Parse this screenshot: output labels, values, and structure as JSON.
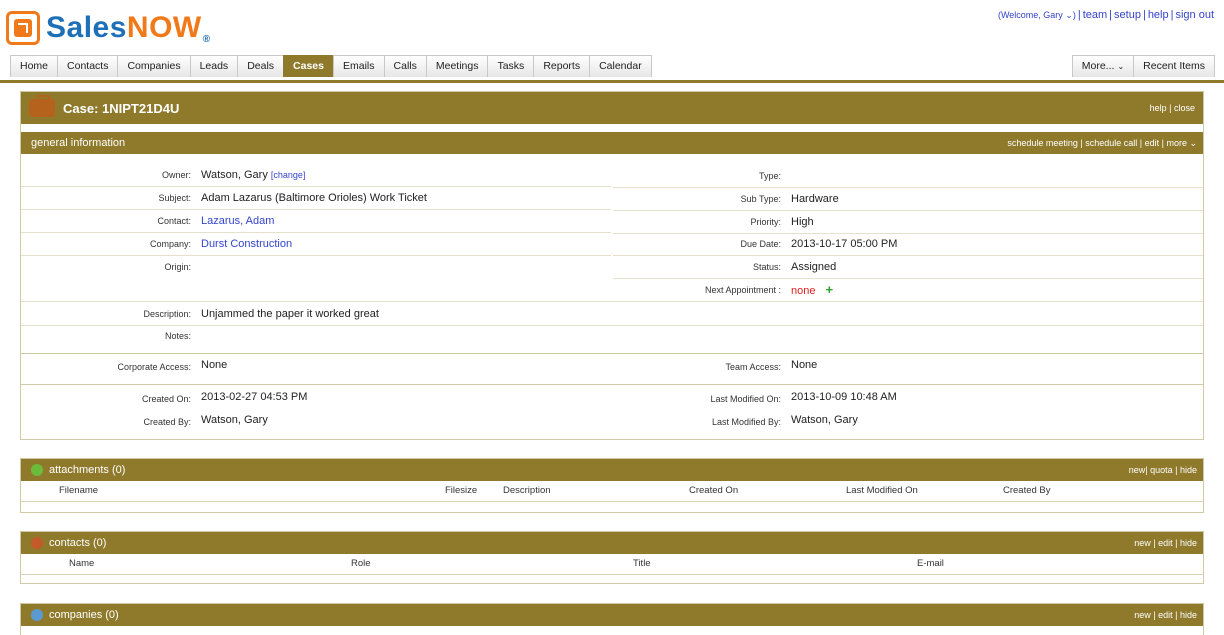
{
  "brand": {
    "sales": "Sales",
    "now": "NOW",
    "reg": "®"
  },
  "toplinks": {
    "welcome": "(Welcome, Gary ⌄)",
    "team": "team",
    "setup": "setup",
    "help": "help",
    "signout": "sign out"
  },
  "tabs": [
    "Home",
    "Contacts",
    "Companies",
    "Leads",
    "Deals",
    "Cases",
    "Emails",
    "Calls",
    "Meetings",
    "Tasks",
    "Reports",
    "Calendar"
  ],
  "active_tab": "Cases",
  "tabs_right": {
    "more": "More...",
    "more_dd": "⌄",
    "recent": "Recent Items"
  },
  "case": {
    "title": "Case: 1NIPT21D4U",
    "head_links": {
      "help": "help",
      "close": "close"
    },
    "section": "general information",
    "section_links": {
      "schedule_meeting": "schedule meeting",
      "schedule_call": "schedule call",
      "edit": "edit",
      "more": "more ⌄"
    },
    "fields_left": [
      {
        "label": "Owner:",
        "value": "Watson, Gary",
        "extra": "[change]"
      },
      {
        "label": "Subject:",
        "value": "Adam Lazarus (Baltimore Orioles) Work Ticket"
      },
      {
        "label": "Contact:",
        "value": "Lazarus, Adam"
      },
      {
        "label": "Company:",
        "value": "Durst Construction"
      },
      {
        "label": "Origin:",
        "value": ""
      }
    ],
    "fields_right": [
      {
        "label": "Type:",
        "value": ""
      },
      {
        "label": "Sub Type:",
        "value": "Hardware"
      },
      {
        "label": "Priority:",
        "value": "High"
      },
      {
        "label": "Due Date:",
        "value": "2013-10-17 05:00 PM"
      },
      {
        "label": "Status:",
        "value": "Assigned"
      },
      {
        "label": "Next Appointment :",
        "value": "none",
        "plus": "+"
      }
    ],
    "description_label": "Description:",
    "description": "Unjammed the paper it worked great",
    "notes_label": "Notes:",
    "corporate_access_label": "Corporate Access:",
    "corporate_access": "None",
    "team_access_label": "Team Access:",
    "team_access": "None",
    "created_on_label": "Created On:",
    "created_on": "2013-02-27 04:53 PM",
    "created_by_label": "Created By:",
    "created_by": "Watson, Gary",
    "modified_on_label": "Last Modified On:",
    "modified_on": "2013-10-09 10:48 AM",
    "modified_by_label": "Last Modified By:",
    "modified_by": "Watson, Gary"
  },
  "attachments": {
    "title": "attachments (0)",
    "links": {
      "new": "new",
      "quota": "quota",
      "hide": "hide"
    },
    "columns": [
      "Filename",
      "Filesize",
      "Description",
      "Created On",
      "Last Modified On",
      "Created By"
    ]
  },
  "contacts": {
    "title": "contacts (0)",
    "links": {
      "new": "new",
      "edit": "edit",
      "hide": "hide"
    },
    "columns": [
      "Name",
      "Role",
      "Title",
      "E-mail"
    ]
  },
  "companies": {
    "title": "companies (0)",
    "links": {
      "new": "new",
      "edit": "edit",
      "hide": "hide"
    }
  },
  "colors": {
    "brand_blue": "#1d6fb8",
    "brand_orange": "#f07a1a",
    "header_gold": "#8f7a2c",
    "link": "#3344cc",
    "warning": "#e02020",
    "add_green": "#2aa52a"
  }
}
